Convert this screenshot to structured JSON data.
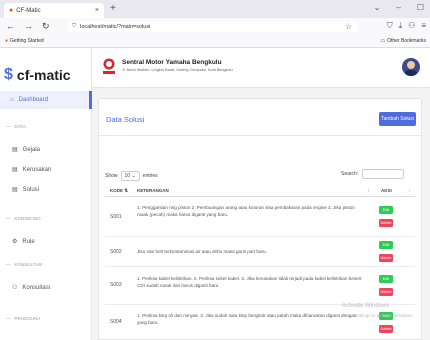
{
  "browser": {
    "tab_title": "CF-Matic",
    "url": "localhost/matic/?main=solusi",
    "bookmark_left": "Getting Started",
    "bookmark_right": "Other Bookmarks"
  },
  "sidebar": {
    "brand": "cf-matic",
    "dashboard": "Dashboard",
    "sections": [
      {
        "title": "DATA",
        "items": [
          "Gejala",
          "Kerusakan",
          "Solusi"
        ]
      },
      {
        "title": "KONSELING",
        "items": [
          "Rule"
        ]
      },
      {
        "title": "KONSULTASI",
        "items": [
          "Konsultasi"
        ]
      },
      {
        "title": "PENGGUNA",
        "items": []
      }
    ]
  },
  "topbar": {
    "company": "Sentral Motor Yamaha Bengkulu",
    "address": "Jl. Bahri Ibrahim, Lingkar Barat, Gading Cempaka, Kota Bengkulu"
  },
  "card": {
    "title": "Data Solusi",
    "add_button": "Tambah Solusi",
    "show_label": "Show",
    "show_value": "10",
    "entries_label": "entries",
    "search_label": "Search:",
    "columns": [
      "KODE",
      "KETERANGAN",
      "AKSI"
    ],
    "edit_label": "Edit",
    "delete_label": "Delete",
    "rows": [
      {
        "code": "S001",
        "text": "1. Penggantian ring piston 2. Pembuangan arang atau kotoran sisa pembakaran pada engine 3. Jika piston rusak (pecah) maka harus diganti yang baru."
      },
      {
        "code": "S002",
        "text": "Jika Van belt terkontaminasi air atau debu maka ganti part baru."
      },
      {
        "code": "S003",
        "text": "1. Periksa kabel kelistrikan. 2. Periksa soket kabel. 3. Jika kerusakan tidak terjadi pada kabel kelistrikan besert CDI sudah rusak dan harus diganti baru."
      },
      {
        "code": "S004",
        "text": "1. Periksa klep oli dan minyak. 2. Jika sudah satu klep bengkok atau patah maka diharuskan diganti dengan yang baru."
      }
    ]
  },
  "watermark": {
    "title": "Activate Windows",
    "subtitle": "Go to Settings to activate Windows."
  }
}
